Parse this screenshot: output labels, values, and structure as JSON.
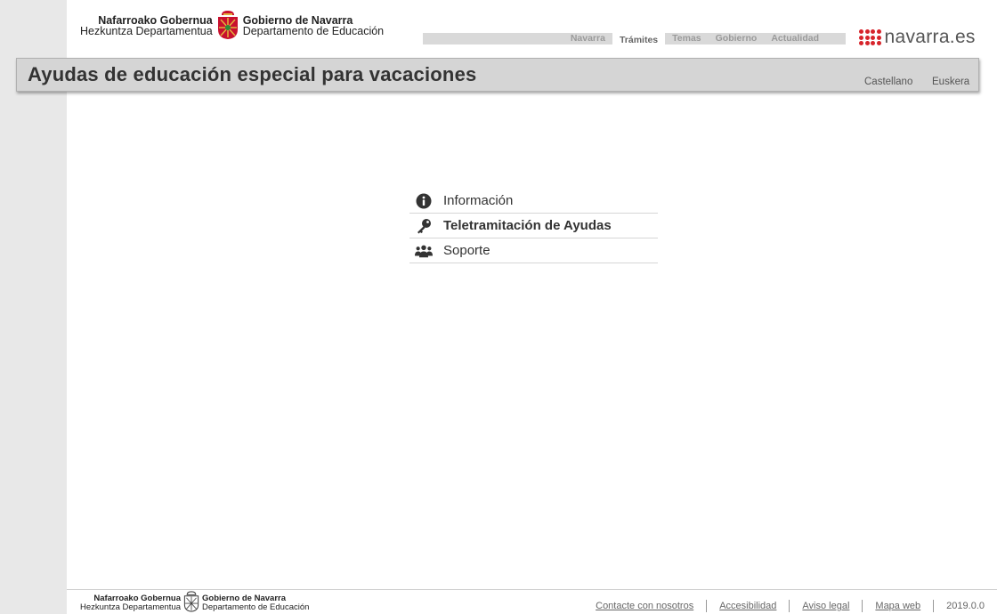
{
  "header": {
    "gov_basque_line1": "Nafarroako Gobernua",
    "gov_basque_line2": "Hezkuntza Departamentua",
    "gov_spanish_line1": "Gobierno de Navarra",
    "gov_spanish_line2": "Departamento de Educación",
    "nav": [
      "Navarra",
      "Trámites",
      "Temas",
      "Gobierno",
      "Actualidad"
    ],
    "nav_active": "Trámites",
    "brand": "navarra.es",
    "brand_color": "#d7242b"
  },
  "title_bar": {
    "title": "Ayudas de educación especial para vacaciones",
    "lang_castellano": "Castellano",
    "lang_euskera": "Euskera"
  },
  "menu": [
    {
      "label": "Información",
      "icon": "info-icon"
    },
    {
      "label": "Teletramitación de Ayudas",
      "icon": "key-icon"
    },
    {
      "label": "Soporte",
      "icon": "users-icon"
    }
  ],
  "footer": {
    "gov_basque_line1": "Nafarroako Gobernua",
    "gov_basque_line2": "Hezkuntza Departamentua",
    "gov_spanish_line1": "Gobierno de Navarra",
    "gov_spanish_line2": "Departamento de Educación",
    "links": [
      "Contacte con nosotros",
      "Accesibilidad",
      "Aviso legal",
      "Mapa web"
    ],
    "version": "2019.0.0"
  }
}
